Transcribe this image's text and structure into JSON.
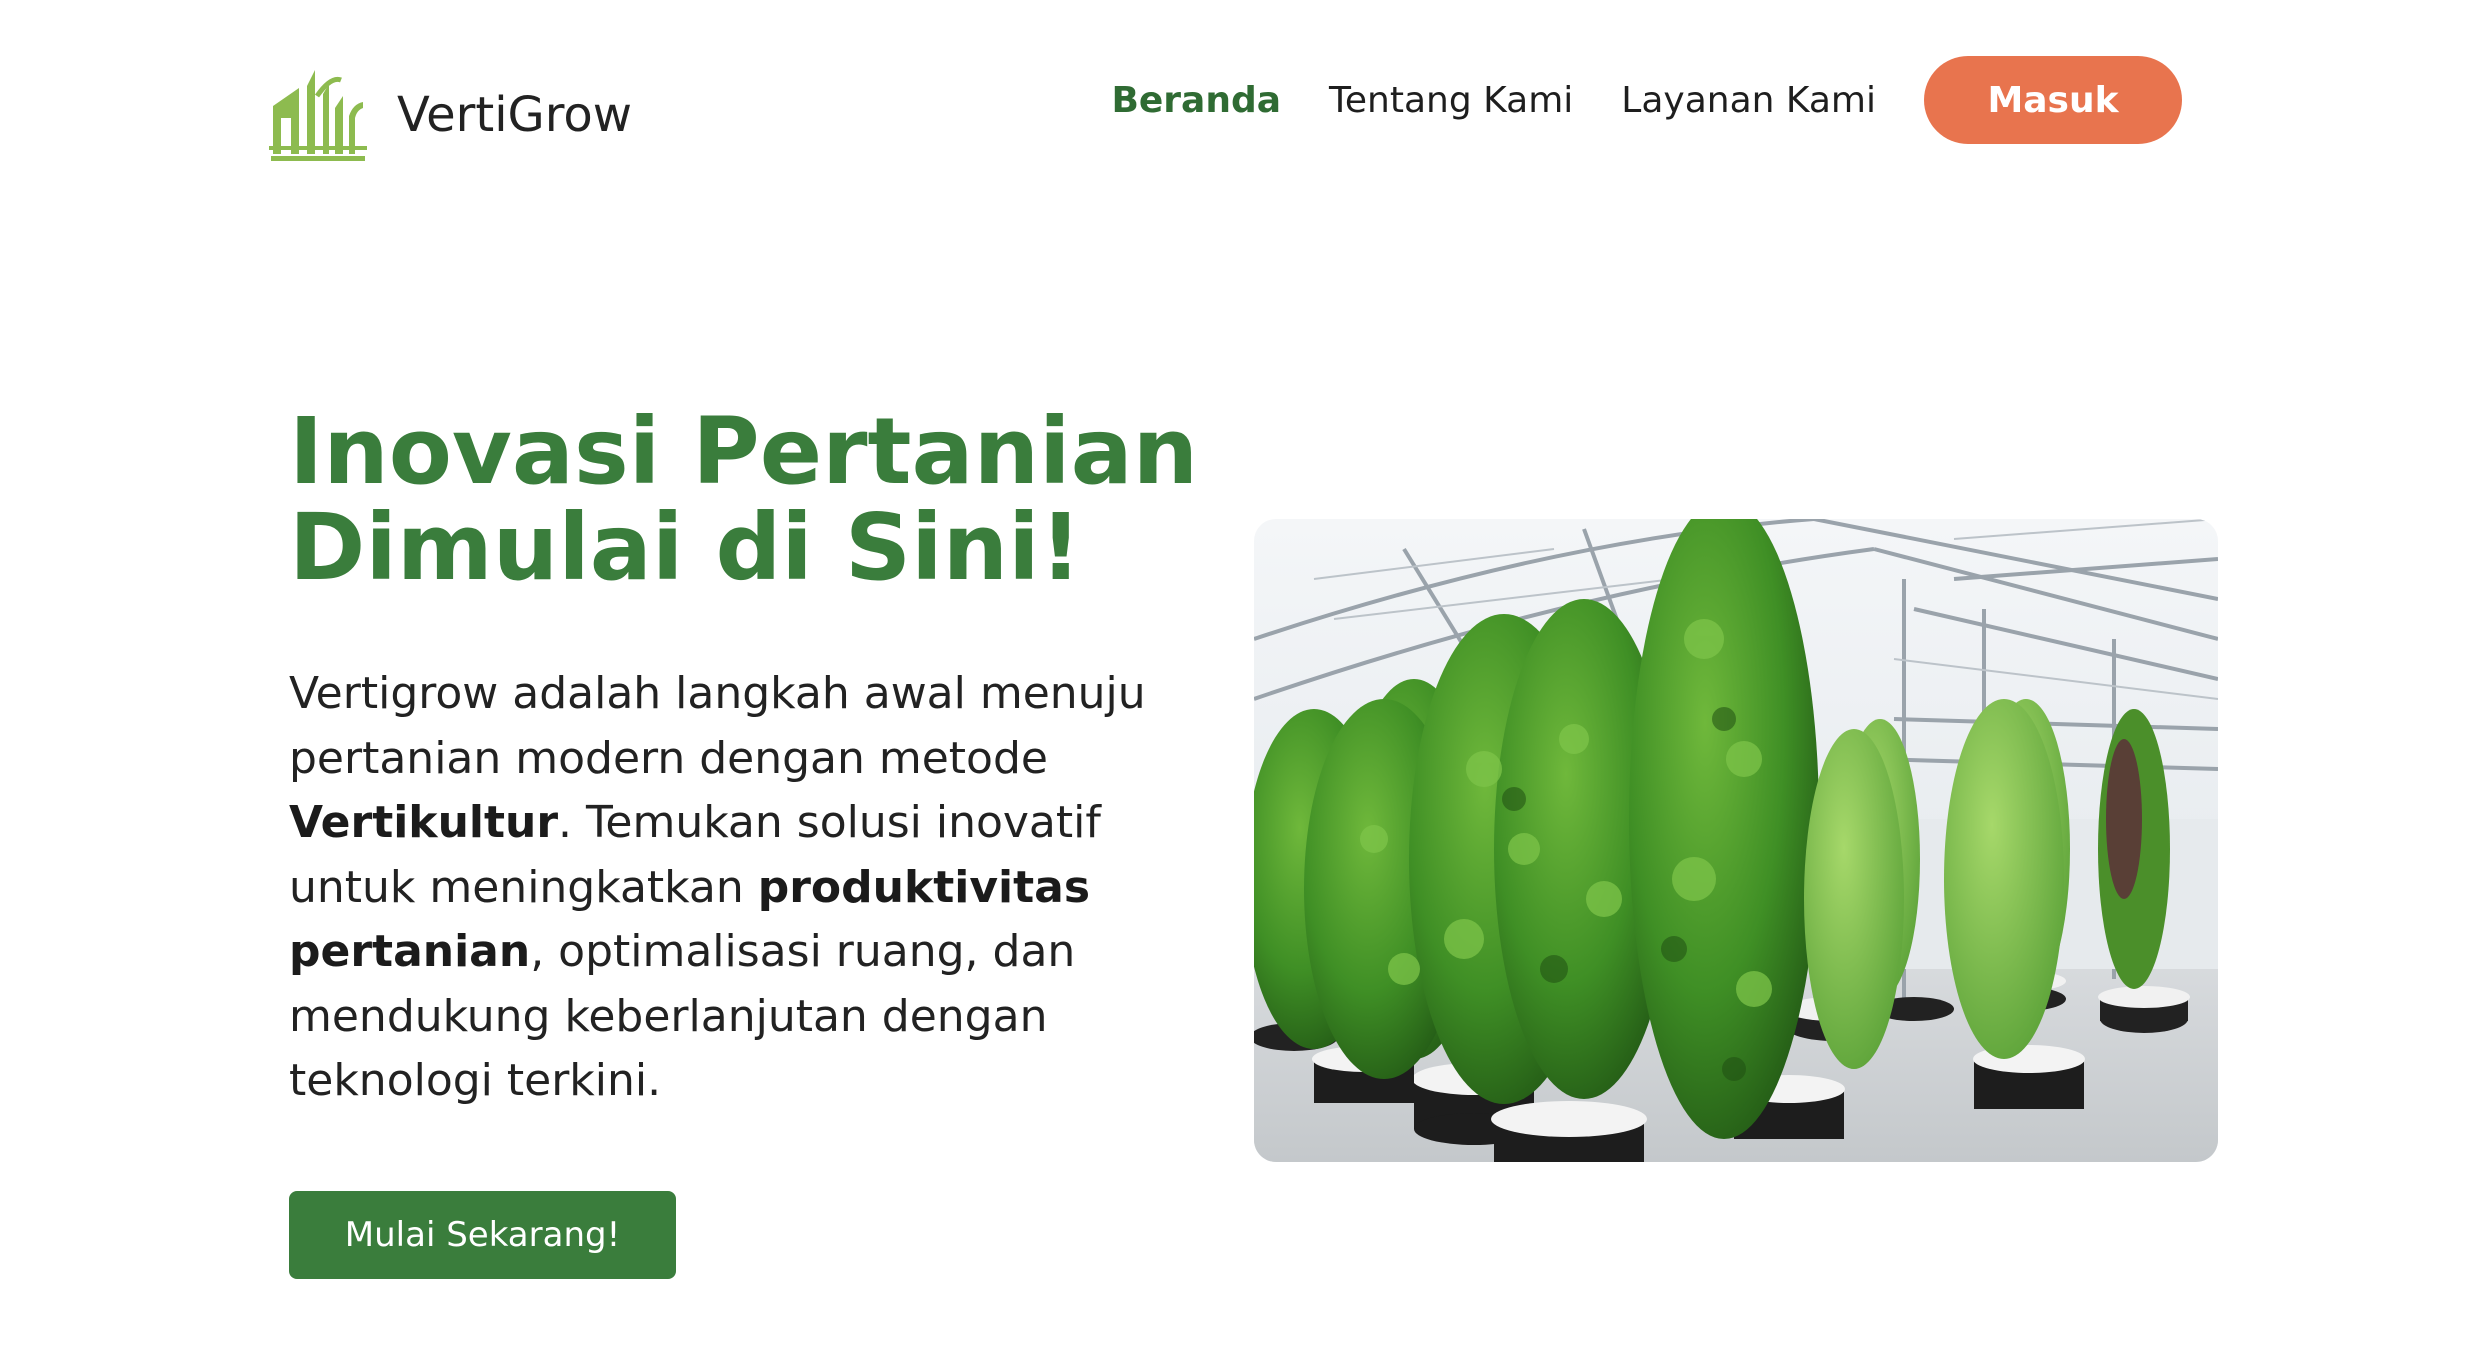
{
  "header": {
    "brand": "VertiGrow",
    "nav": [
      {
        "label": "Beranda",
        "active": true
      },
      {
        "label": "Tentang Kami",
        "active": false
      },
      {
        "label": "Layanan Kami",
        "active": false
      }
    ],
    "login_label": "Masuk"
  },
  "hero": {
    "title_line1": "Inovasi Pertanian",
    "title_line2": "Dimulai di Sini!",
    "desc_1": "Vertigrow adalah langkah awal menuju",
    "desc_2": "pertanian modern dengan metode",
    "desc_3_bold": "Vertikultur",
    "desc_3_rest": ". Temukan solusi inovatif",
    "desc_4": "untuk meningkatkan ",
    "desc_4_bold": "produktivitas",
    "desc_5_bold": "pertanian",
    "desc_5_rest": ", optimalisasi ruang, dan",
    "desc_6": "mendukung keberlanjutan dengan",
    "desc_7": "teknologi terkini.",
    "cta_label": "Mulai Sekarang!"
  },
  "colors": {
    "brand_green": "#3a7d3c",
    "nav_active": "#2f6b33",
    "login_button": "#e8744e",
    "logo_green": "#8dbb4f"
  },
  "icons": {
    "logo": "vertical-farm-logo-icon",
    "hero_image": "vertical-tower-garden-greenhouse-photo"
  }
}
